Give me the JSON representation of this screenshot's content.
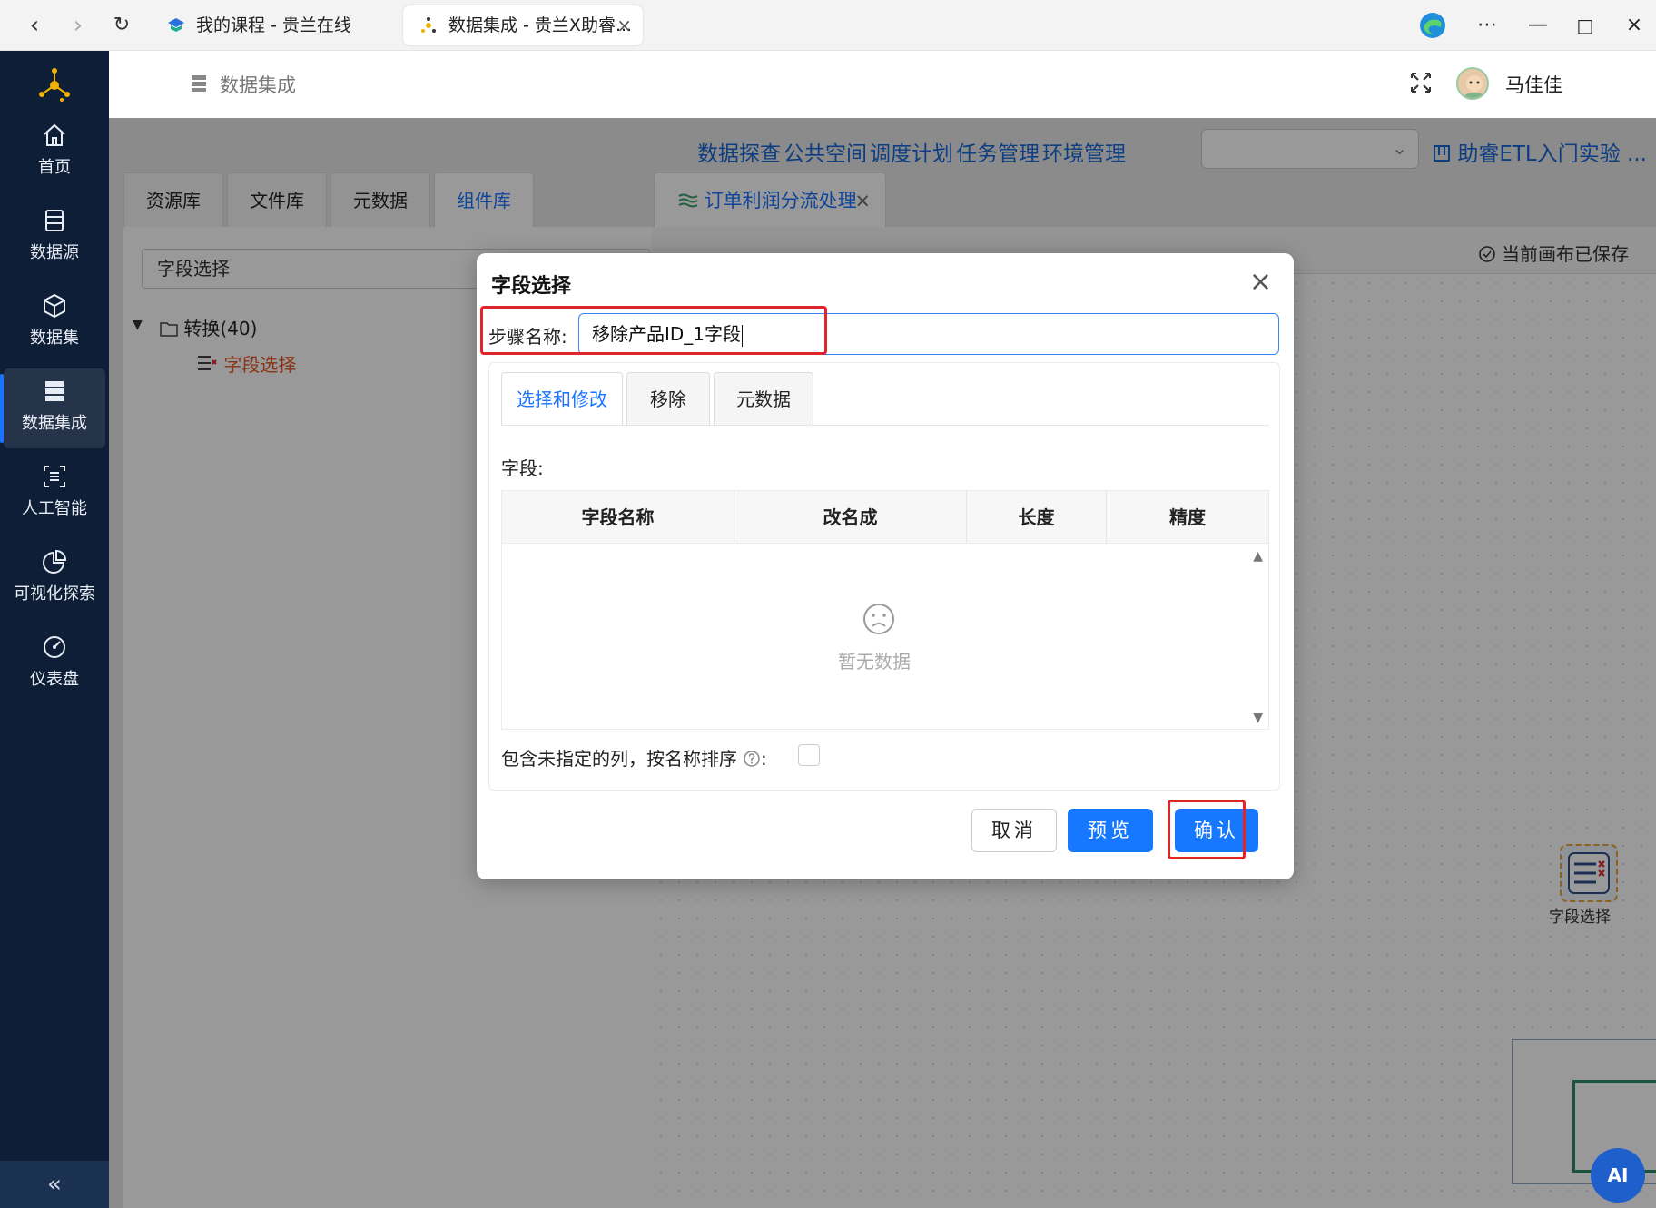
{
  "browser": {
    "tabs": [
      {
        "title": "我的课程 - 贵兰在线"
      },
      {
        "title": "数据集成 - 贵兰X助睿..."
      }
    ]
  },
  "sidebar": {
    "items": [
      {
        "label": "首页",
        "icon": "home-icon"
      },
      {
        "label": "数据源",
        "icon": "database-icon"
      },
      {
        "label": "数据集",
        "icon": "cube-icon"
      },
      {
        "label": "数据集成",
        "icon": "server-icon"
      },
      {
        "label": "人工智能",
        "icon": "ai-icon"
      },
      {
        "label": "可视化探索",
        "icon": "pie-chart-icon"
      },
      {
        "label": "仪表盘",
        "icon": "gauge-icon"
      }
    ],
    "collapse_label": "«"
  },
  "header": {
    "breadcrumb": "数据集成",
    "username": "马佳佳"
  },
  "topnav": {
    "links": [
      "数据探查",
      "公共空间",
      "调度计划",
      "任务管理",
      "环境管理"
    ],
    "project": "助睿ETL入门实验 ..."
  },
  "library": {
    "tabs": [
      "资源库",
      "文件库",
      "元数据",
      "组件库"
    ],
    "search_value": "字段选择",
    "tree_parent": "转换(40)",
    "tree_child": "字段选择"
  },
  "canvas": {
    "tab_title": "订单利润分流处理",
    "saved_status": "当前画布已保存",
    "node_label": "字段选择",
    "ai_label": "AI"
  },
  "dialog": {
    "title": "字段选择",
    "step_label": "步骤名称:",
    "step_value": "移除产品ID_1字段",
    "tabs": [
      "选择和修改",
      "移除",
      "元数据"
    ],
    "fields_label": "字段:",
    "columns": [
      "字段名称",
      "改名成",
      "长度",
      "精度"
    ],
    "empty_text": "暂无数据",
    "include_label": "包含未指定的列，按名称排序",
    "include_colon": ":",
    "buttons": {
      "cancel": "取消",
      "preview": "预览",
      "confirm": "确认"
    }
  },
  "colors": {
    "accent": "#1677ff",
    "sidebar_bg": "#0d1e36",
    "highlight_red": "#e0252b"
  }
}
